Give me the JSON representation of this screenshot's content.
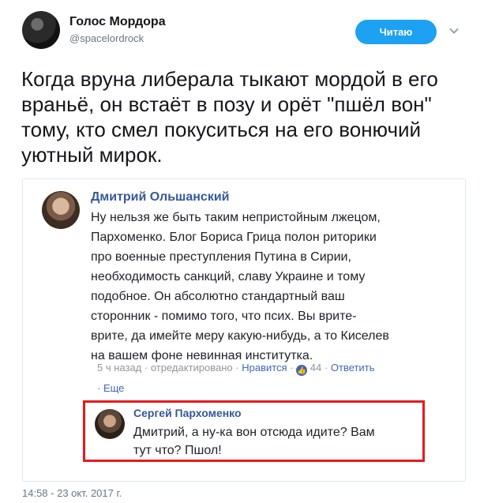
{
  "tweet": {
    "author_name": "Голос Мордора",
    "author_handle": "@spacelordrock",
    "follow_label": "Читаю",
    "text": "Когда вруна либерала тыкают мордой в его\nвраньё, он встаёт в позу и орёт \"пшёл вон\"\nтому, кто смел покуситься на его вонючий\nуютный мирок.",
    "timestamp": "14:58 - 23 окт. 2017 г."
  },
  "screenshot": {
    "comment1": {
      "author": "Дмитрий Ольшанский",
      "text": "Ну нельзя же быть таким непристойным лжецом,\nПархоменко. Блог Бориса Грица полон риторики\nпро военные преступления Путина в Сирии,\nнеобходимость санкций, славу Украине и тому\nподобное. Он абсолютно стандартный ваш\nсторонник - помимо того, что псих. Вы врите-\nврите, да имейте меру какую-нибудь, а то Киселев\nна вашем фоне невинная институтка.",
      "time": "5 ч назад",
      "edited": "отредактировано",
      "like_label": "Нравится",
      "likes": "44",
      "reply_label": "Ответить",
      "more_label": "Еще"
    },
    "comment2": {
      "author": "Сергей Пархоменко",
      "text": "Дмитрий, а ну-ка вон отсюда идите? Вам\nтут что? Пшол!"
    },
    "colors": {
      "highlight_border": "#e8191c",
      "fb_link": "#365899",
      "twitter_blue": "#1da1f2"
    }
  }
}
